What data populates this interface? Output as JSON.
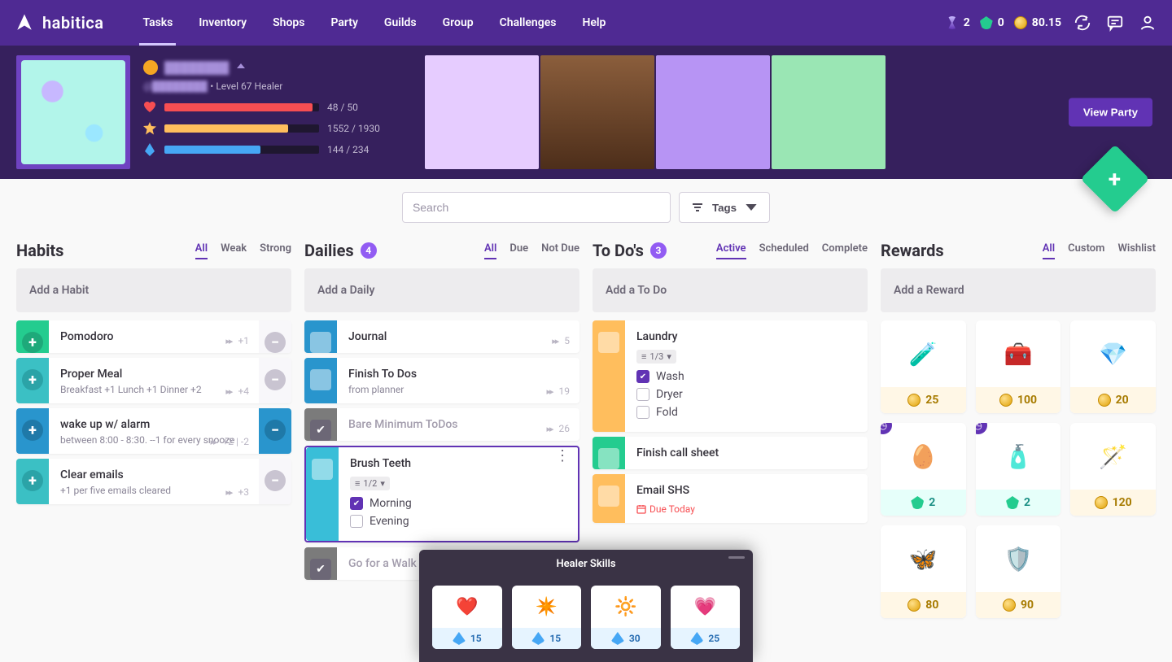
{
  "brand": "habitica",
  "nav": {
    "items": [
      "Tasks",
      "Inventory",
      "Shops",
      "Party",
      "Guilds",
      "Group",
      "Challenges",
      "Help"
    ],
    "active": "Tasks"
  },
  "currencies": {
    "hourglass": 2,
    "gems": 0,
    "gold": "80.15"
  },
  "player": {
    "name": "████████",
    "handle": "@████████",
    "class_line": "Level 67 Healer",
    "hp_text": "48 / 50",
    "xp_text": "1552 / 1930",
    "mp_text": "144 / 234"
  },
  "view_party_label": "View Party",
  "search": {
    "placeholder": "Search",
    "tags_label": "Tags"
  },
  "columns": {
    "habits": {
      "title": "Habits",
      "filters": [
        "All",
        "Weak",
        "Strong"
      ],
      "active_filter": "All",
      "add_placeholder": "Add a Habit"
    },
    "dailies": {
      "title": "Dailies",
      "count": 4,
      "filters": [
        "All",
        "Due",
        "Not Due"
      ],
      "active_filter": "All",
      "add_placeholder": "Add a Daily"
    },
    "todos": {
      "title": "To Do's",
      "count": 3,
      "filters": [
        "Active",
        "Scheduled",
        "Complete"
      ],
      "active_filter": "Active",
      "add_placeholder": "Add a To Do"
    },
    "rewards": {
      "title": "Rewards",
      "filters": [
        "All",
        "Custom",
        "Wishlist"
      ],
      "active_filter": "All",
      "add_placeholder": "Add a Reward"
    }
  },
  "habits": [
    {
      "title": "Pomodoro",
      "note": "",
      "streak": "+1"
    },
    {
      "title": "Proper Meal",
      "note": "Breakfast +1 Lunch +1 Dinner +2",
      "streak": "+4"
    },
    {
      "title": "wake up w/ alarm",
      "note": "between 8:00 - 8:30. --1 for every snooze",
      "streak": "+2 | -2"
    },
    {
      "title": "Clear emails",
      "note": "+1 per five emails cleared",
      "streak": "+3"
    }
  ],
  "dailies": [
    {
      "title": "Journal",
      "note": "",
      "streak": "5"
    },
    {
      "title": "Finish To Dos",
      "note": "from planner",
      "streak": "19"
    },
    {
      "title": "Bare Minimum ToDos",
      "note": "",
      "streak": "26",
      "done": true
    },
    {
      "title": "Brush Teeth",
      "sub_pill": "1/2",
      "subs": [
        {
          "label": "Morning",
          "done": true
        },
        {
          "label": "Evening",
          "done": false
        }
      ]
    },
    {
      "title": "Go for a Walk",
      "note": "",
      "done": true
    }
  ],
  "todos": [
    {
      "title": "Laundry",
      "sub_pill": "1/3",
      "subs": [
        {
          "label": "Wash",
          "done": true
        },
        {
          "label": "Dryer",
          "done": false
        },
        {
          "label": "Fold",
          "done": false
        }
      ]
    },
    {
      "title": "Finish call sheet"
    },
    {
      "title": "Email SHS",
      "due": "Due Today"
    }
  ],
  "rewards": [
    {
      "icon": "potion",
      "price": "25",
      "kind": "gold"
    },
    {
      "icon": "chest",
      "price": "100",
      "kind": "gold"
    },
    {
      "icon": "gem",
      "price": "20",
      "kind": "gold"
    },
    {
      "icon": "egg",
      "price": "2",
      "kind": "gem",
      "badge": true
    },
    {
      "icon": "bottle",
      "price": "2",
      "kind": "gem",
      "badge": true
    },
    {
      "icon": "wand",
      "price": "120",
      "kind": "gold"
    },
    {
      "icon": "wings",
      "price": "80",
      "kind": "gold"
    },
    {
      "icon": "shield",
      "price": "90",
      "kind": "gold"
    }
  ],
  "skills": {
    "title": "Healer Skills",
    "items": [
      {
        "name": "heal",
        "cost": "15"
      },
      {
        "name": "burst",
        "cost": "15"
      },
      {
        "name": "protect",
        "cost": "30"
      },
      {
        "name": "bless",
        "cost": "25"
      }
    ]
  }
}
